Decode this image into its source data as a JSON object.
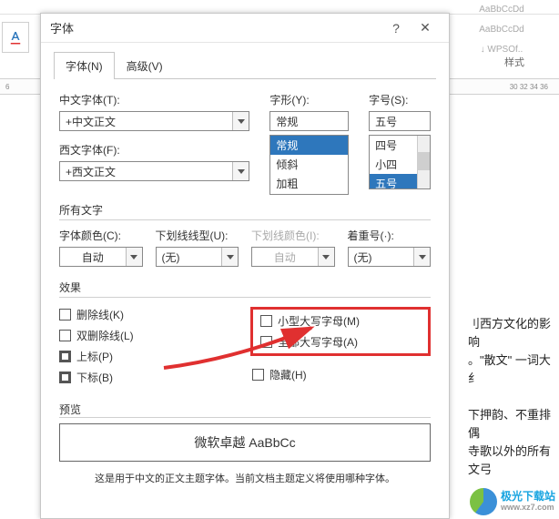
{
  "dialog": {
    "title": "字体",
    "help_char": "?",
    "close_char": "✕"
  },
  "tabs": {
    "font": "字体(N)",
    "advanced": "高级(V)"
  },
  "cn_font": {
    "label": "中文字体(T):",
    "value": "+中文正文"
  },
  "west_font": {
    "label": "西文字体(F):",
    "value": "+西文正文"
  },
  "style": {
    "label": "字形(Y):",
    "value": "常规",
    "opts": [
      "常规",
      "倾斜",
      "加粗"
    ]
  },
  "size": {
    "label": "字号(S):",
    "value": "五号",
    "opts": [
      "四号",
      "小四",
      "五号"
    ]
  },
  "alltext_label": "所有文字",
  "fontcolor": {
    "label": "字体颜色(C):",
    "value": "自动"
  },
  "underline": {
    "label": "下划线线型(U):",
    "value": "(无)"
  },
  "ulinecolor": {
    "label": "下划线颜色(I):",
    "value": "自动"
  },
  "emphasis": {
    "label": "着重号(·):",
    "value": "(无)"
  },
  "effects_label": "效果",
  "effects": {
    "strike": "删除线(K)",
    "dstrike": "双删除线(L)",
    "sup": "上标(P)",
    "sub": "下标(B)",
    "smallcaps": "小型大写字母(M)",
    "allcaps": "全部大写字母(A)",
    "hidden": "隐藏(H)"
  },
  "preview_label": "预览",
  "preview_text": "微软卓越 AaBbCc",
  "hint": "这是用于中文的正文主题字体。当前文档主题定义将使用哪种字体。",
  "bg": {
    "style1": "AaBbCcDd",
    "style2": "AaBbCcDd",
    "style3": "↓ WPSOf..",
    "styles_label": "样式",
    "ruler_left": "6",
    "ruler_right": "30   32   34   36",
    "doc1": "刂西方文化的影响",
    "doc2": "。\"散文\" 一词大纟",
    "doc3": "下押韵、不重排偶",
    "doc4": "寺歌以外的所有文弓",
    "logo_txt": "极光下载站",
    "logo_url": "www.xz7.com"
  }
}
